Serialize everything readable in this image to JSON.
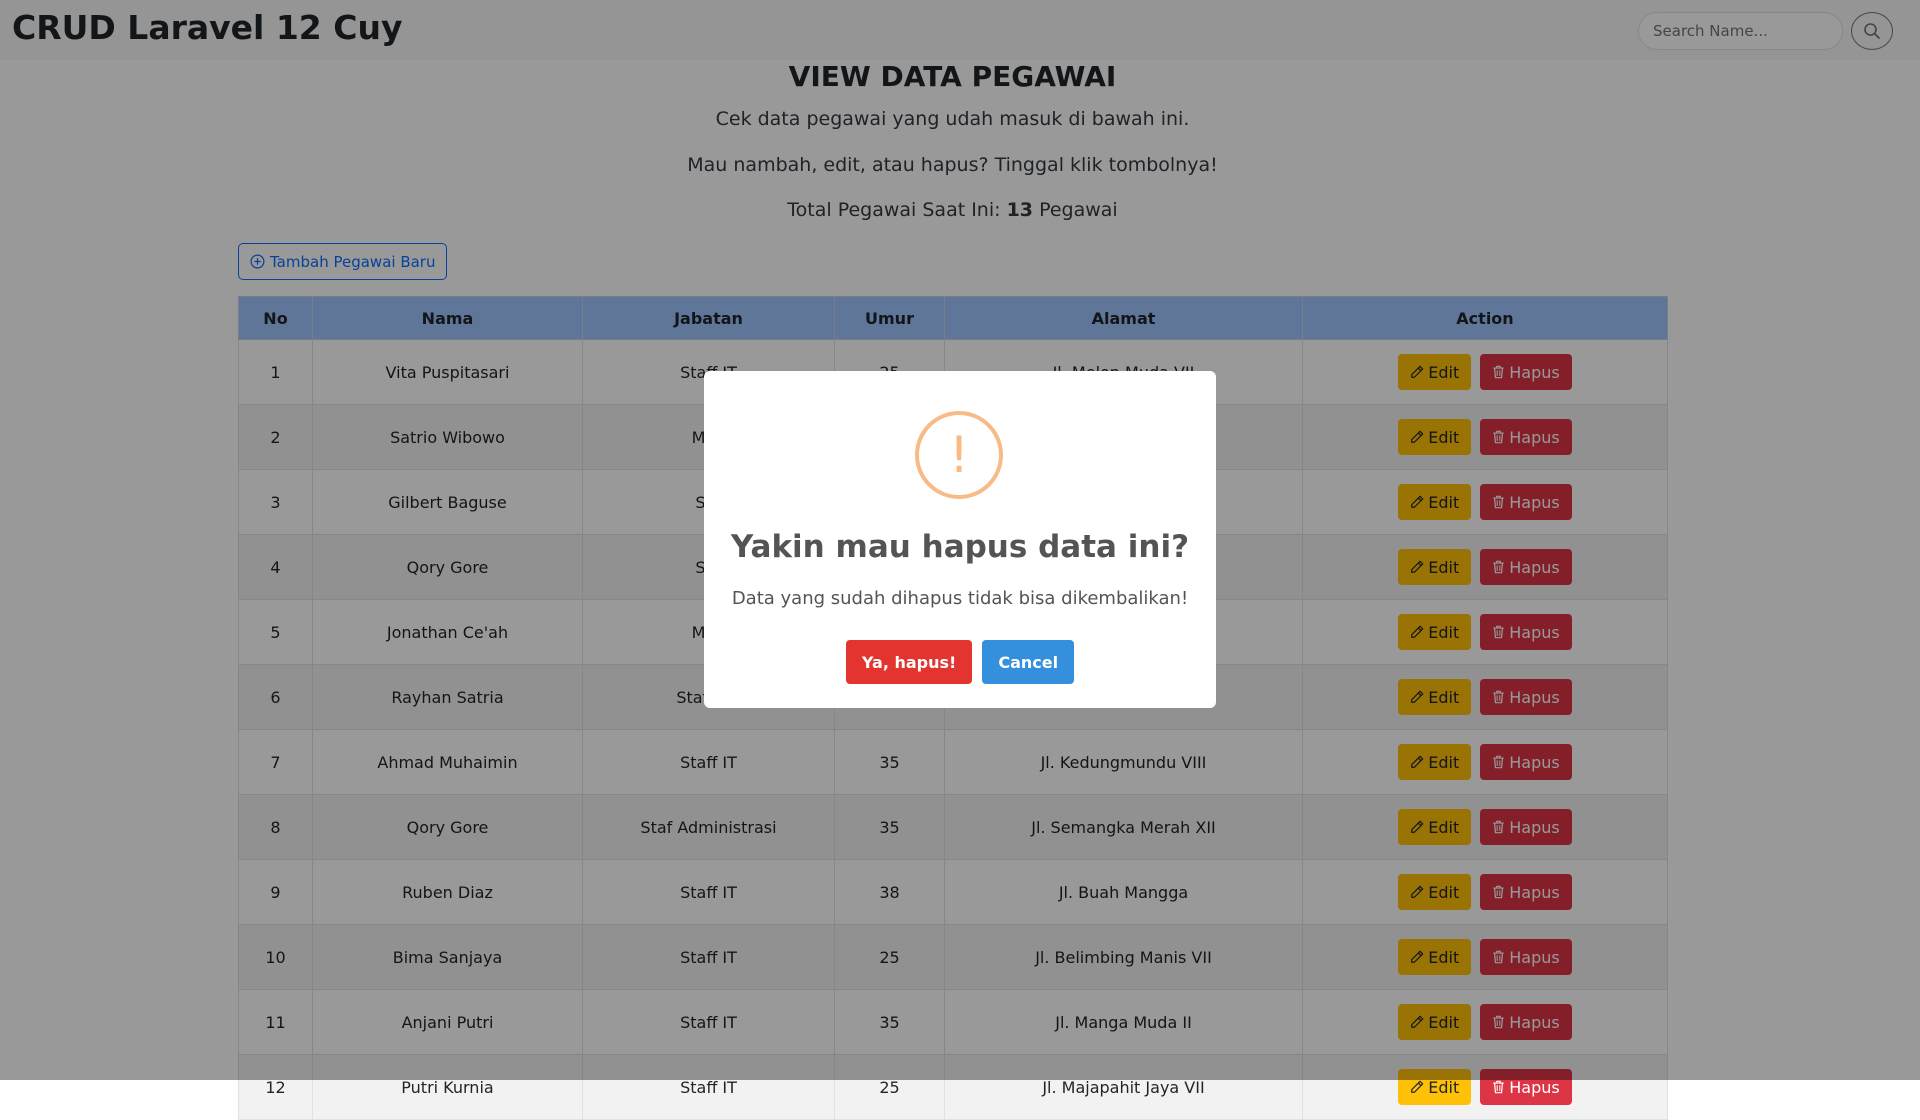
{
  "navbar": {
    "brand": "CRUD Laravel 12 Cuy",
    "search_placeholder": "Search Name...",
    "search_icon": "search-icon"
  },
  "header": {
    "title": "VIEW DATA PEGAWAI",
    "line1": "Cek data pegawai yang udah masuk di bawah ini.",
    "line2": "Mau nambah, edit, atau hapus? Tinggal klik tombolnya!",
    "total_prefix": "Total Pegawai Saat Ini: ",
    "total_count": "13",
    "total_suffix": " Pegawai"
  },
  "add_button": {
    "label": "Tambah Pegawai Baru",
    "icon": "plus-circle-icon"
  },
  "table": {
    "columns": [
      "No",
      "Nama",
      "Jabatan",
      "Umur",
      "Alamat",
      "Action"
    ],
    "rows": [
      {
        "no": "1",
        "nama": "Vita Puspitasari",
        "jabatan": "Staff IT",
        "umur": "25",
        "alamat": "Jl. Melon Muda VII"
      },
      {
        "no": "2",
        "nama": "Satrio Wibowo",
        "jabatan": "Man",
        "umur": "",
        "alamat": ""
      },
      {
        "no": "3",
        "nama": "Gilbert Baguse",
        "jabatan": "Sta",
        "umur": "",
        "alamat": ""
      },
      {
        "no": "4",
        "nama": "Qory Gore",
        "jabatan": "Sta",
        "umur": "",
        "alamat": ""
      },
      {
        "no": "5",
        "nama": "Jonathan Ce'ah",
        "jabatan": "Man",
        "umur": "",
        "alamat": ""
      },
      {
        "no": "6",
        "nama": "Rayhan Satria",
        "jabatan": "Staf Adr",
        "umur": "",
        "alamat": ""
      },
      {
        "no": "7",
        "nama": "Ahmad Muhaimin",
        "jabatan": "Staff IT",
        "umur": "35",
        "alamat": "Jl. Kedungmundu VIII"
      },
      {
        "no": "8",
        "nama": "Qory Gore",
        "jabatan": "Staf Administrasi",
        "umur": "35",
        "alamat": "Jl. Semangka Merah XII"
      },
      {
        "no": "9",
        "nama": "Ruben Diaz",
        "jabatan": "Staff IT",
        "umur": "38",
        "alamat": "Jl. Buah Mangga"
      },
      {
        "no": "10",
        "nama": "Bima Sanjaya",
        "jabatan": "Staff IT",
        "umur": "25",
        "alamat": "Jl. Belimbing Manis VII"
      },
      {
        "no": "11",
        "nama": "Anjani Putri",
        "jabatan": "Staff IT",
        "umur": "35",
        "alamat": "Jl. Manga Muda II"
      },
      {
        "no": "12",
        "nama": "Putri Kurnia",
        "jabatan": "Staff IT",
        "umur": "25",
        "alamat": "Jl. Majapahit Jaya VII"
      }
    ],
    "edit_label": "Edit",
    "edit_icon": "pencil-icon",
    "delete_label": "Hapus",
    "delete_icon": "trash-icon"
  },
  "modal": {
    "icon_symbol": "!",
    "icon": "warning-icon",
    "title": "Yakin mau hapus data ini?",
    "text": "Data yang sudah dihapus tidak bisa dikembalikan!",
    "confirm_label": "Ya, hapus!",
    "cancel_label": "Cancel"
  },
  "colors": {
    "header_bg": "#9ec5fe",
    "edit": "#ffc107",
    "delete": "#dc3545",
    "confirm": "#e3342f",
    "cancel": "#3490dc",
    "warning": "#f8bb86"
  }
}
